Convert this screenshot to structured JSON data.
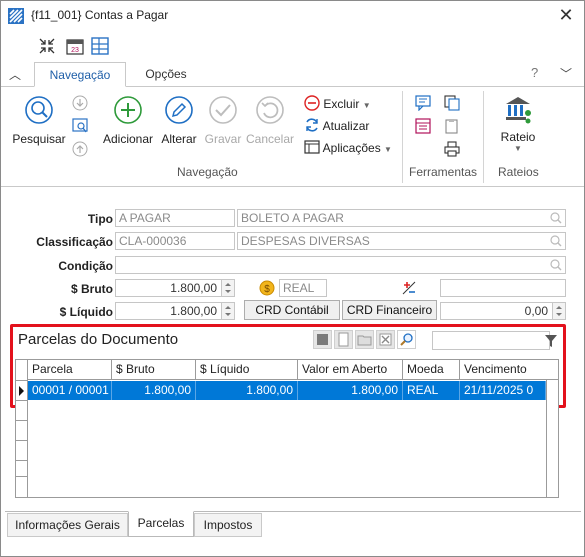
{
  "window": {
    "title": "{f11_001}  Contas a Pagar",
    "close_glyph": "✕"
  },
  "quick_access": [
    "collapse-arrows-icon",
    "calendar-icon",
    "grid-layout-icon"
  ],
  "ribbon": {
    "tabs": [
      {
        "label": "Navegação",
        "active": true
      },
      {
        "label": "Opções",
        "active": false
      }
    ],
    "help": "?",
    "groups": {
      "navegacao": {
        "label": "Navegação",
        "pesquisar": "Pesquisar",
        "adicionar": "Adicionar",
        "alterar": "Alterar",
        "gravar": "Gravar",
        "cancelar": "Cancelar",
        "excluir": "Excluir",
        "atualizar": "Atualizar",
        "aplicacoes": "Aplicações"
      },
      "ferramentas": {
        "label": "Ferramentas"
      },
      "rateios": {
        "label": "Rateios",
        "rateio": "Rateio"
      }
    }
  },
  "form": {
    "tipo": {
      "label": "Tipo",
      "code": "A PAGAR",
      "desc": "BOLETO A PAGAR"
    },
    "classificacao": {
      "label": "Classificação",
      "code": "CLA-000036",
      "desc": "DESPESAS DIVERSAS"
    },
    "condicao": {
      "label": "Condição",
      "value": ""
    },
    "bruto": {
      "label": "$ Bruto",
      "value": "1.800,00"
    },
    "liquido": {
      "label": "$ Líquido",
      "value": "1.800,00"
    },
    "moeda": "REAL",
    "crd_contabil": "CRD Contábil",
    "crd_financeiro": "CRD Financeiro",
    "extra_value": "0,00"
  },
  "parcelas": {
    "title": "Parcelas do Documento",
    "columns": [
      "Parcela",
      "$ Bruto",
      "$ Líquido",
      "Valor em Aberto",
      "Moeda",
      "Vencimento"
    ],
    "rows": [
      [
        "00001 / 00001",
        "1.800,00",
        "1.800,00",
        "1.800,00",
        "REAL",
        "21/11/2025 0"
      ]
    ]
  },
  "bottom_tabs": [
    {
      "label": "Informações Gerais",
      "active": false
    },
    {
      "label": "Parcelas",
      "active": true
    },
    {
      "label": "Impostos",
      "active": false
    }
  ],
  "colors": {
    "accent": "#1f5fa8",
    "selection": "#0078d7",
    "highlight_frame": "#e3111c"
  }
}
